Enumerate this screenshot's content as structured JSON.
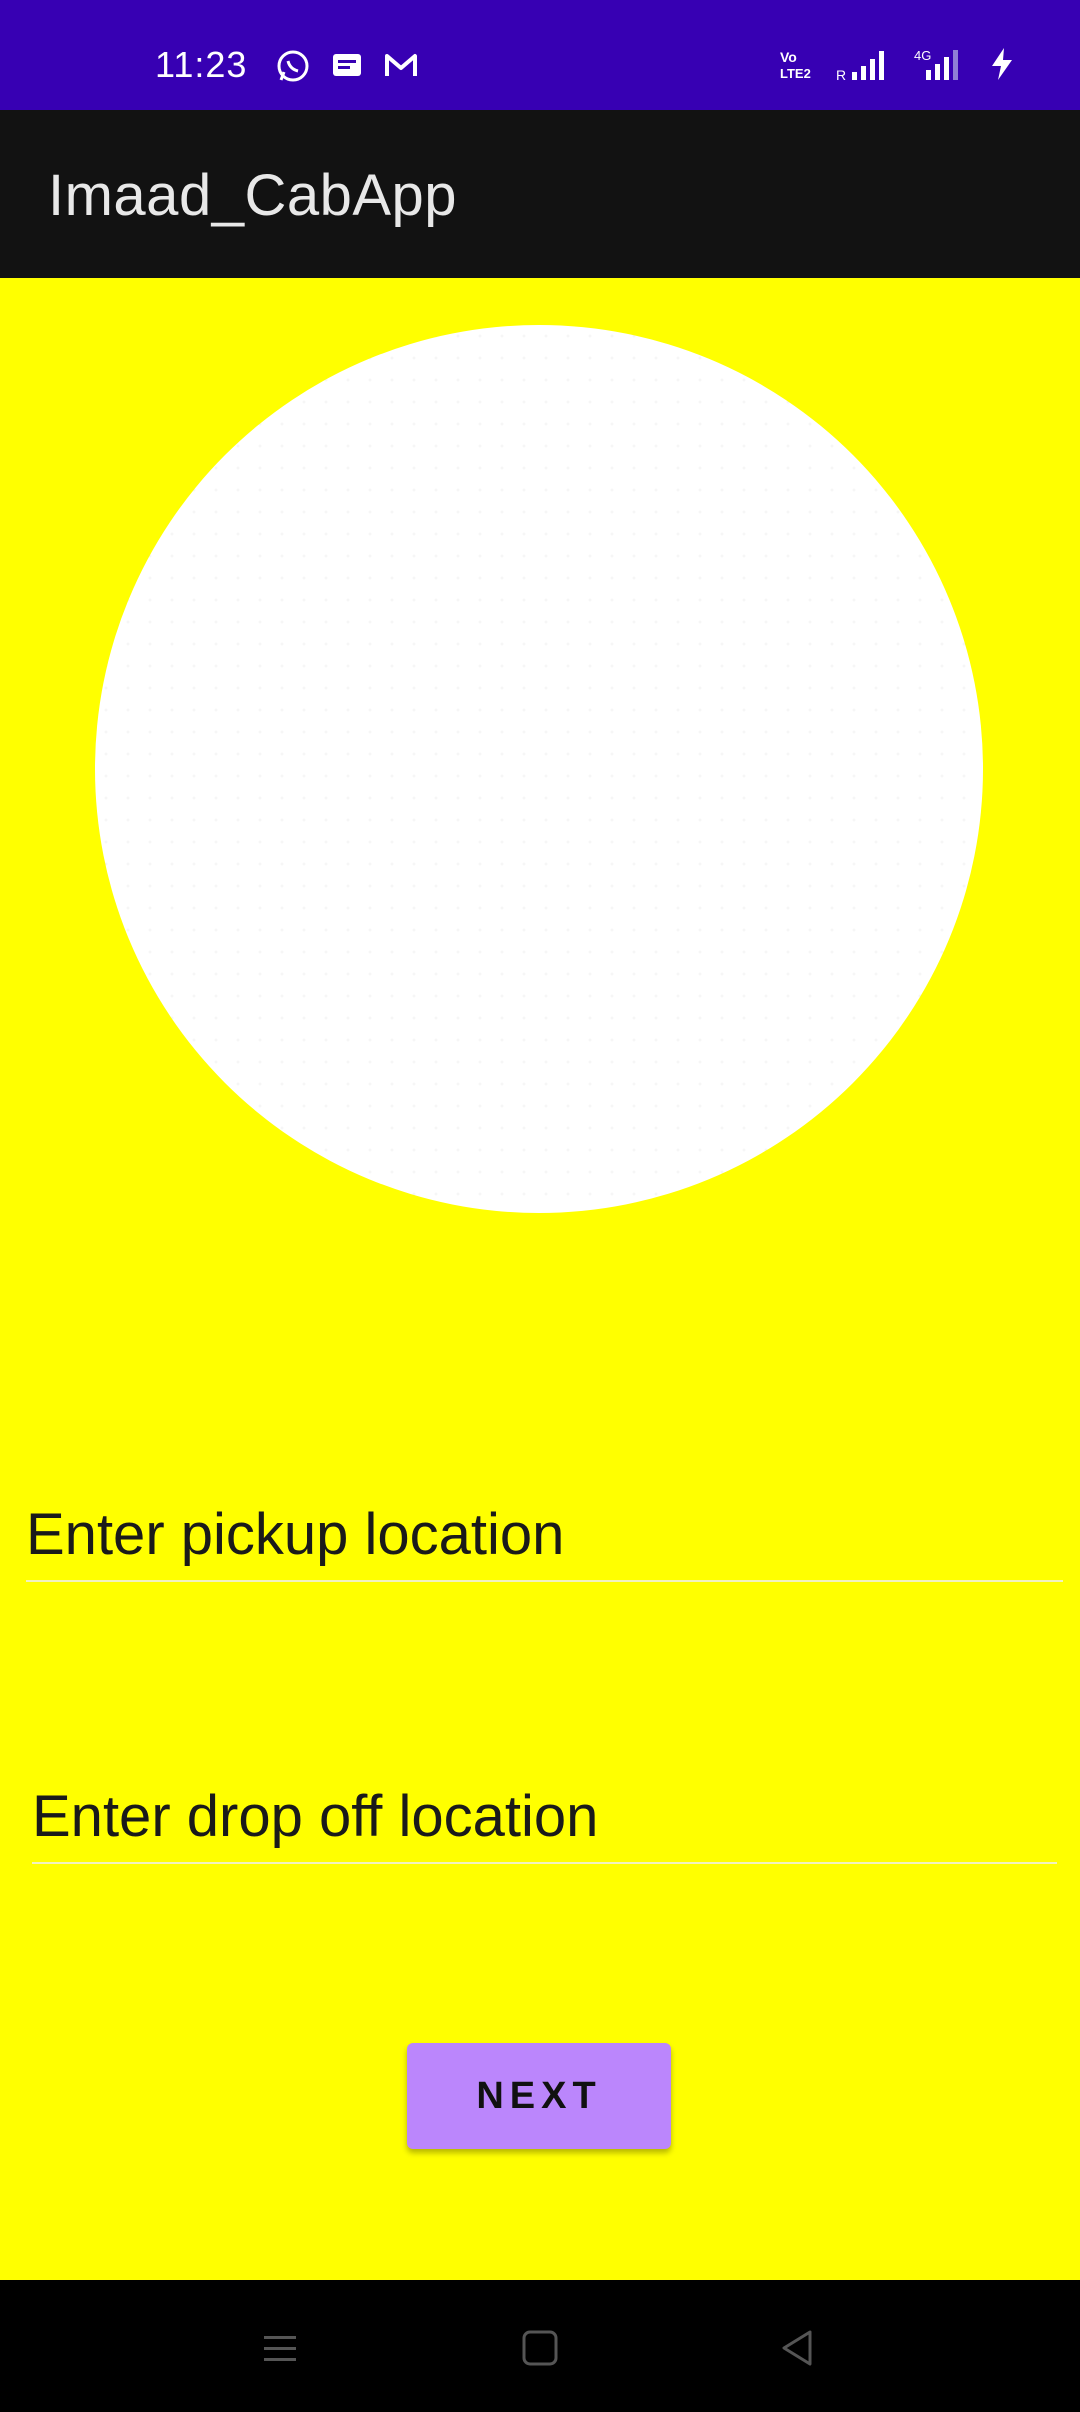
{
  "status_bar": {
    "time": "11:23",
    "left_icons": [
      "whatsapp-icon",
      "message-icon",
      "gmail-icon"
    ],
    "right_icons": [
      "volte-icon",
      "signal-roaming-icon",
      "signal-4g-icon",
      "charging-icon"
    ],
    "color": "#3700b3"
  },
  "app_bar": {
    "title": "Imaad_CabApp",
    "color": "#121212"
  },
  "main": {
    "background": "#ffff00",
    "image": "circle-image",
    "pickup_placeholder": "Enter pickup location",
    "dropoff_placeholder": "Enter drop off location",
    "next_label": "NEXT",
    "button_color": "#bb86fc"
  },
  "nav_bar": {
    "buttons": [
      "menu-icon",
      "home-icon",
      "back-icon"
    ]
  }
}
